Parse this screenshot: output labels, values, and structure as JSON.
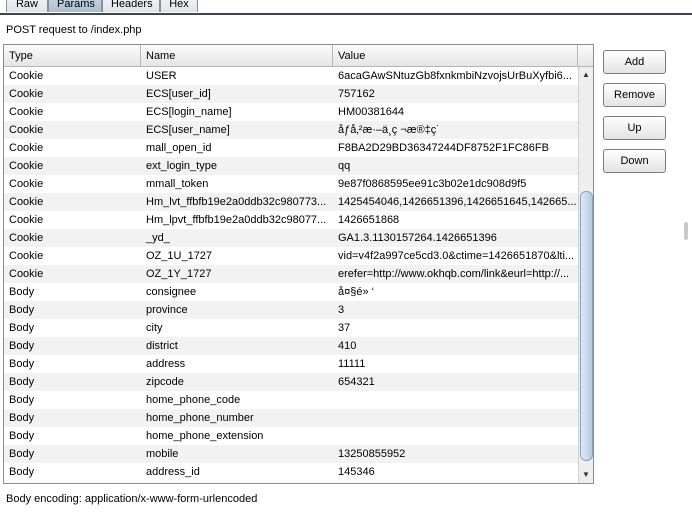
{
  "tabs": [
    {
      "label": "Raw",
      "active": false
    },
    {
      "label": "Params",
      "active": true
    },
    {
      "label": "Headers",
      "active": false
    },
    {
      "label": "Hex",
      "active": false
    }
  ],
  "request_title": "POST request to /index.php",
  "table": {
    "columns": [
      "Type",
      "Name",
      "Value"
    ],
    "rows": [
      [
        "Cookie",
        "USER",
        "6acaGAwSNtuzGb8fxnkmbiNzvojsUrBuXyfbi6..."
      ],
      [
        "Cookie",
        "ECS[user_id]",
        "757162"
      ],
      [
        "Cookie",
        "ECS[login_name]",
        "HM00381644"
      ],
      [
        "Cookie",
        "ECS[user_name]",
        "åƒå‚²æ·–ä¸ç ¬æ®‡ç˙"
      ],
      [
        "Cookie",
        "mall_open_id",
        "F8BA2D29BD36347244DF8752F1FC86FB"
      ],
      [
        "Cookie",
        "ext_login_type",
        "qq"
      ],
      [
        "Cookie",
        "mmall_token",
        "9e87f0868595ee91c3b02e1dc908d9f5"
      ],
      [
        "Cookie",
        "Hm_lvt_ffbfb19e2a0ddb32c980773...",
        "1425454046,1426651396,1426651645,142665..."
      ],
      [
        "Cookie",
        "Hm_lpvt_ffbfb19e2a0ddb32c98077...",
        "1426651868"
      ],
      [
        "Cookie",
        "_yd_",
        "GA1.3.1130157264.1426651396"
      ],
      [
        "Cookie",
        "OZ_1U_1727",
        "vid=v4f2a997ce5cd3.0&ctime=1426651870&lti..."
      ],
      [
        "Cookie",
        "OZ_1Y_1727",
        "erefer=http://www.okhqb.com/link&eurl=http://..."
      ],
      [
        "Body",
        "consignee",
        "å¤§é» ‘"
      ],
      [
        "Body",
        "province",
        "3"
      ],
      [
        "Body",
        "city",
        "37"
      ],
      [
        "Body",
        "district",
        "410"
      ],
      [
        "Body",
        "address",
        "11111"
      ],
      [
        "Body",
        "zipcode",
        "654321"
      ],
      [
        "Body",
        "home_phone_code",
        ""
      ],
      [
        "Body",
        "home_phone_number",
        ""
      ],
      [
        "Body",
        "home_phone_extension",
        ""
      ],
      [
        "Body",
        "mobile",
        "13250855952"
      ],
      [
        "Body",
        "address_id",
        "145346"
      ]
    ]
  },
  "buttons": {
    "add": "Add",
    "remove": "Remove",
    "up": "Up",
    "down": "Down"
  },
  "scrollbar": {
    "up_icon": "triangle-up-icon",
    "down_icon": "triangle-down-icon"
  },
  "encoding": {
    "label": "Body encoding:",
    "value": "application/x-www-form-urlencoded"
  }
}
